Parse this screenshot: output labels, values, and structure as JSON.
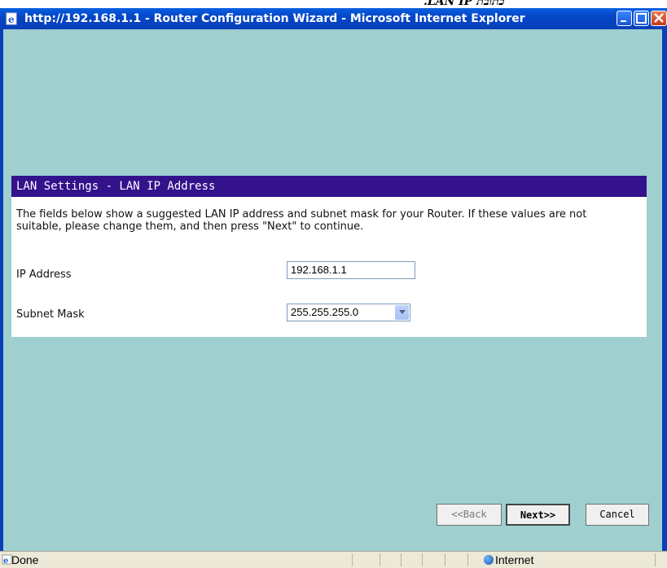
{
  "window": {
    "title": "http://192.168.1.1 - Router Configuration Wizard - Microsoft Internet Explorer",
    "top_clip_text": ".LAN  IP  כתובת"
  },
  "panel": {
    "header": "LAN Settings - LAN IP Address",
    "description": "The fields below show a suggested LAN IP address and subnet mask for your Router. If these values are not suitable, please change them, and then press \"Next\" to continue.",
    "ip_label": "IP Address",
    "ip_value": "192.168.1.1",
    "mask_label": "Subnet Mask",
    "mask_value": "255.255.255.0"
  },
  "buttons": {
    "back": "<<Back",
    "next": "Next>>",
    "cancel": "Cancel"
  },
  "statusbar": {
    "status": "Done",
    "zone": "Internet"
  },
  "colors": {
    "titlebar": "#0447c7",
    "background": "#9fcfcf",
    "panel_header": "#33128c"
  }
}
